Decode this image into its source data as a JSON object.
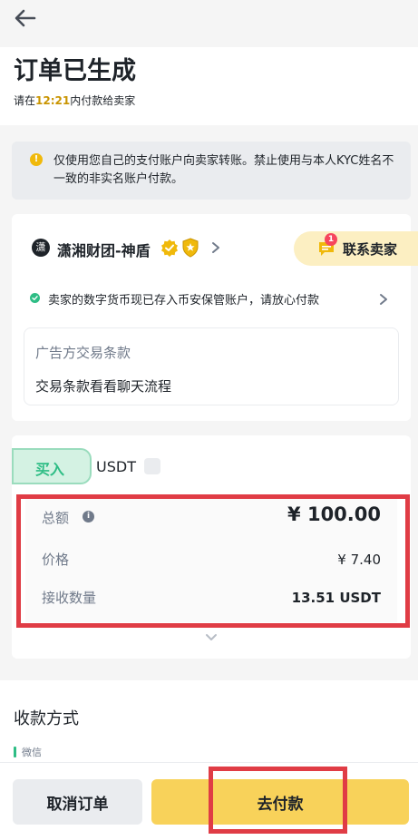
{
  "header": {
    "title": "订单已生成",
    "subtitle_prefix": "请在",
    "time": "12:21",
    "subtitle_suffix": "内付款给卖家"
  },
  "notice": {
    "icon": "warning-icon",
    "text": "仅使用您自己的支付账户向卖家转账。禁止使用与本人KYC姓名不一致的非实名账户付款。"
  },
  "seller": {
    "avatar_char": "潇",
    "name": "潇湘财团-神盾",
    "contact_label": "联系卖家",
    "unread_count": "1",
    "escrow_text": "卖家的数字货币现已存入币安保管账户，请放心付款",
    "terms_title": "广告方交易条款",
    "terms_body": "交易条款看看聊天流程"
  },
  "order": {
    "side_label": "买入",
    "coin": "USDT",
    "total_label": "总额",
    "total_value": "¥ 100.00",
    "price_label": "价格",
    "price_value": "¥ 7.40",
    "qty_label": "接收数量",
    "qty_value": "13.51 USDT"
  },
  "payment": {
    "title": "收款方式",
    "method": "微信"
  },
  "actions": {
    "cancel_label": "取消订单",
    "pay_label": "去付款"
  },
  "colors": {
    "accent": "#f0b90b",
    "buy_green": "#2ebd85",
    "highlight_red": "#e03c45",
    "timer": "#c99400"
  }
}
